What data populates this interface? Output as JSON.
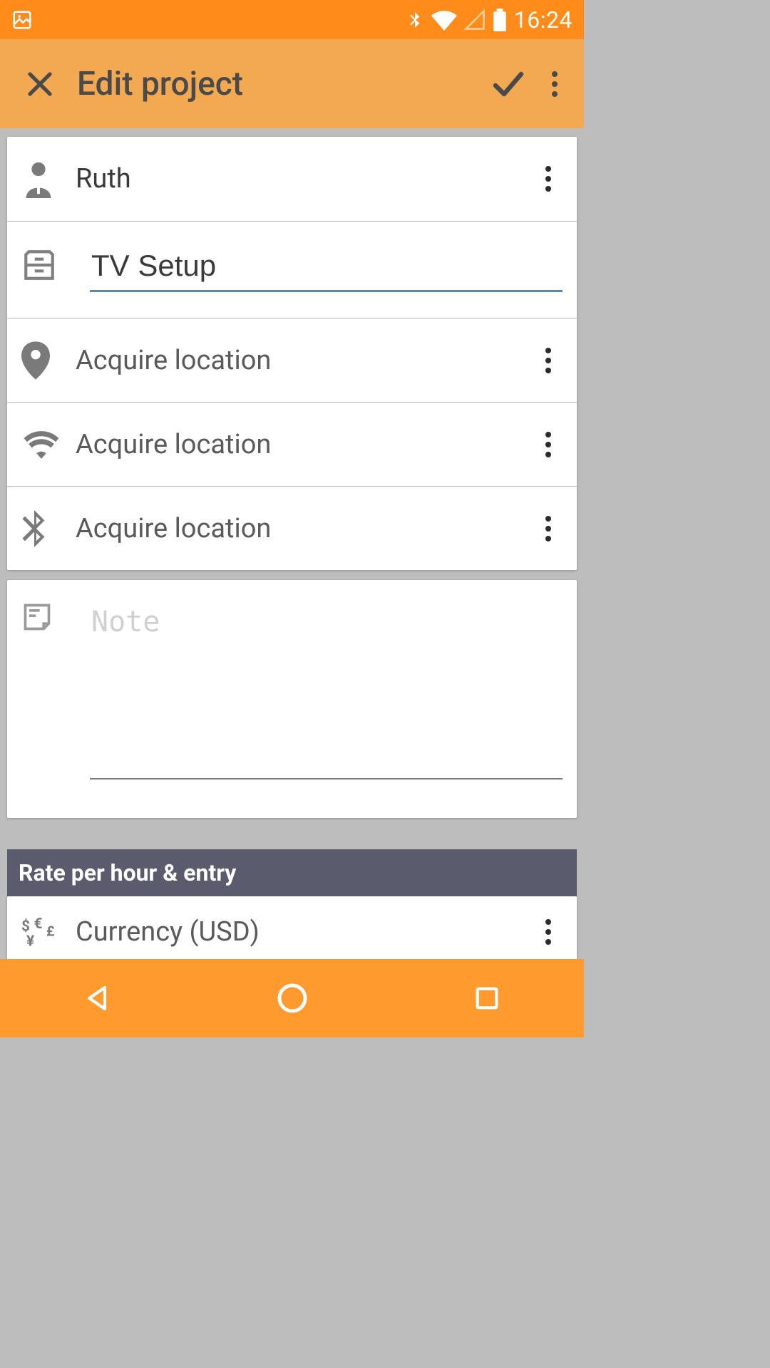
{
  "status": {
    "time": "16:24"
  },
  "toolbar": {
    "title": "Edit project"
  },
  "client": {
    "name": "Ruth"
  },
  "project": {
    "name": "TV Setup"
  },
  "locations": {
    "gps": {
      "label": "Acquire location"
    },
    "wifi": {
      "label": "Acquire location"
    },
    "bt": {
      "label": "Acquire location"
    }
  },
  "note": {
    "placeholder": "Note",
    "value": ""
  },
  "sections": {
    "rate": "Rate per hour & entry"
  },
  "currency": {
    "label": "Currency (USD)"
  },
  "colors": {
    "accent": "#ff9a2e",
    "status": "#ff8c1a",
    "underline": "#5a8aa6"
  }
}
